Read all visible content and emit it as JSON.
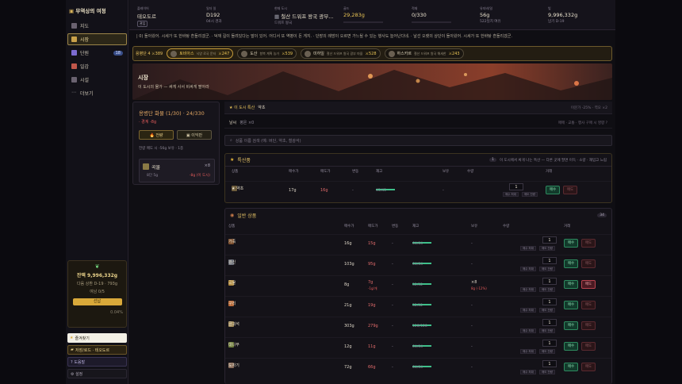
{
  "sidebar": {
    "brand": "무역상의 여정",
    "items": [
      {
        "label": "지도",
        "icon": "map-icon"
      },
      {
        "label": "시장",
        "icon": "market-icon"
      },
      {
        "label": "단원",
        "icon": "crew-icon",
        "badge": "18"
      },
      {
        "label": "일감",
        "icon": "quest-icon"
      },
      {
        "label": "시설",
        "icon": "facility-icon"
      },
      {
        "label": "더보기",
        "icon": "more-icon"
      }
    ],
    "wealth": {
      "title": "잔액 9,996,332g",
      "next": "다음 상환 D-19 · 793g",
      "lend": "여남 0/5",
      "button": "선납",
      "rate": "0.04%"
    },
    "links": {
      "favorite": "즐겨찾기",
      "save": "저장/로드 · 테오도르",
      "help": "? 도움말",
      "settings": "⚙ 설정"
    }
  },
  "topbar": {
    "merchant": {
      "label": "플레이어",
      "value": "테오도르",
      "tag": "관입"
    },
    "day": {
      "label": "일자 일",
      "value": "D192",
      "sub": "04시 경과"
    },
    "location": {
      "label": "현재 도시",
      "value": "철산 드워프 왕국 광부...",
      "sub": "드워프 왕국"
    },
    "gold": {
      "label": "골드",
      "value": "29,283g"
    },
    "cargo": {
      "label": "적재",
      "value": "0/330"
    },
    "upkeep": {
      "label": "유지비/일",
      "value": "56g",
      "sub": "522일치 여유"
    },
    "bank": {
      "label": "빚",
      "value": "9,996,332g",
      "sub": "납기 D-19"
    }
  },
  "ticker": "| 0) 돌아왔어. 시세가 또 한바탕 흔들리겠군.   ·   덕재 길이 돌려있다는 말이 있어. 어디서 또 역병이 돈 게지.   ·   단장의 례방이 오르면 가느될 수 있는 행사도 늘어난다네.   ·   날선 오랫의 상단이 돌아왔어. 시세가 또 한바탕 흔들리겠군.",
  "events": {
    "prefix": "용병단 4 ⚔389",
    "chips": [
      {
        "name": "토비아스",
        "desc": "낙양 로국 문저",
        "power": "⚔247"
      },
      {
        "name": "도산",
        "desc": "항복 계획 농가",
        "power": "⚔539"
      },
      {
        "name": "미하일",
        "desc": "철산 드워프 왕국 광부 마을",
        "power": "⚔528"
      },
      {
        "name": "하스카르",
        "desc": "철산 드워프 왕국 해세한",
        "power": "⚔243"
      }
    ]
  },
  "hero": {
    "title": "시장",
    "subtitle": "이 도시의 물가 — 싸게 사서 비싸게 팔아라"
  },
  "loan": {
    "title": "용병단 화물 (1/30) · 24/330",
    "status": "· 경계 -8g",
    "btn_left": "전량",
    "btn_right": "이익만",
    "note": "전량 매도 시 -56g 보유 · 1종",
    "item": {
      "name": "곡물",
      "qty": "×8",
      "price": "8단 5g",
      "loss": "-8g (이 도시)"
    }
  },
  "market": {
    "specialty_label": "★ 이 도시 특산",
    "specialty_value": "약초",
    "specialty_right": "이문가 -25% · 역오 ×2",
    "mood_label": "날씨",
    "mood_value": "평온 ×0",
    "mood_right": "매매 · 교통 · 행사 구매 시 영향 ?",
    "search_placeholder": "상품 이름 검색 (예: 버단, 약초, 철광석)",
    "special": {
      "title": "특산품",
      "count": "1",
      "note": "이 도시에서 싸게 나는 특산 — 다른 곳에 팔면 이득 · 소량 · 재입고 느림",
      "columns": [
        "상품",
        "매수가",
        "매도가",
        "변동",
        "재고",
        "보유",
        "수량",
        "거래"
      ],
      "rows": [
        {
          "name": "★ 약초",
          "buy": "17g",
          "sell": "16g",
          "change": "-",
          "stock": "45/45",
          "fill": 1.0,
          "held": "-",
          "qty": "1"
        }
      ]
    },
    "general": {
      "title": "일반 상품",
      "count": "34",
      "columns": [
        "상품",
        "매수가",
        "매도가",
        "변동",
        "재고",
        "보유",
        "수량",
        "거래"
      ],
      "rows": [
        {
          "name": "가죽",
          "buy": "16g",
          "sell": "15g",
          "change": "-",
          "stock": "64/64",
          "fill": 1.0,
          "held": "-",
          "qty": "1"
        },
        {
          "name": "검신",
          "buy": "103g",
          "sell": "95g",
          "change": "-",
          "stock": "64/64",
          "fill": 1.0,
          "held": "-",
          "qty": "1"
        },
        {
          "name": "곡물",
          "buy": "8g",
          "sell": "7g",
          "sell_sub": "-1g/개",
          "change": "-",
          "stock": "32/32",
          "fill": 1.0,
          "held": "×8",
          "held_sub": "8g (-12%)",
          "qty": "1",
          "sell_on": true
        },
        {
          "name": "구리",
          "buy": "21g",
          "sell": "19g",
          "change": "-",
          "stock": "32/32",
          "fill": 1.0,
          "held": "-",
          "qty": "1"
        },
        {
          "name": "금괴석",
          "buy": "303g",
          "sell": "279g",
          "change": "-",
          "stock": "128/128",
          "fill": 1.0,
          "held": "-",
          "qty": "1"
        },
        {
          "name": "대나무",
          "buy": "12g",
          "sell": "11g",
          "change": "-",
          "stock": "64/64",
          "fill": 1.0,
          "held": "-",
          "qty": "1"
        },
        {
          "name": "도자기",
          "buy": "72g",
          "sell": "66g",
          "change": "-",
          "stock": "64/64",
          "fill": 1.0,
          "held": "-",
          "qty": "1"
        }
      ]
    },
    "buy_label": "매수",
    "sell_label": "매도",
    "mini_a": "매수 최대",
    "mini_b": "매도 전량"
  }
}
